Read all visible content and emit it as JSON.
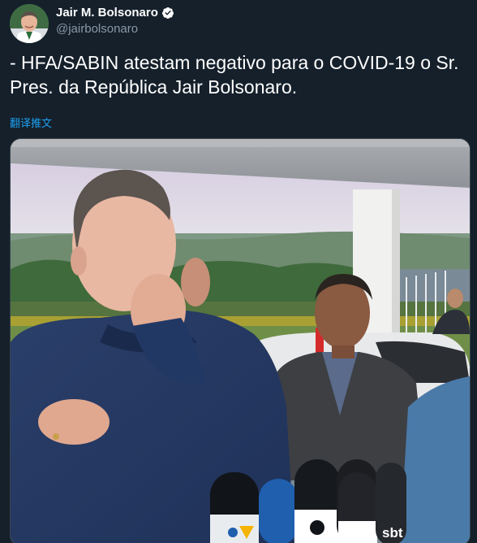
{
  "tweet": {
    "author": {
      "display_name": "Jair M. Bolsonaro",
      "handle": "@jairbolsonaro",
      "verified": true,
      "avatar_icon": "profile-photo"
    },
    "text": "- HFA/SABIN atestam negativo para o COVID-19 o Sr. Pres. da República Jair Bolsonaro.",
    "translate_label": "翻译推文",
    "media": {
      "type": "photo",
      "microphone_logos": [
        "sbt"
      ]
    }
  },
  "colors": {
    "background": "#15202b",
    "text_primary": "#ffffff",
    "text_secondary": "#8899a6",
    "link": "#1da1f2",
    "verified_badge": "#ffffff"
  }
}
